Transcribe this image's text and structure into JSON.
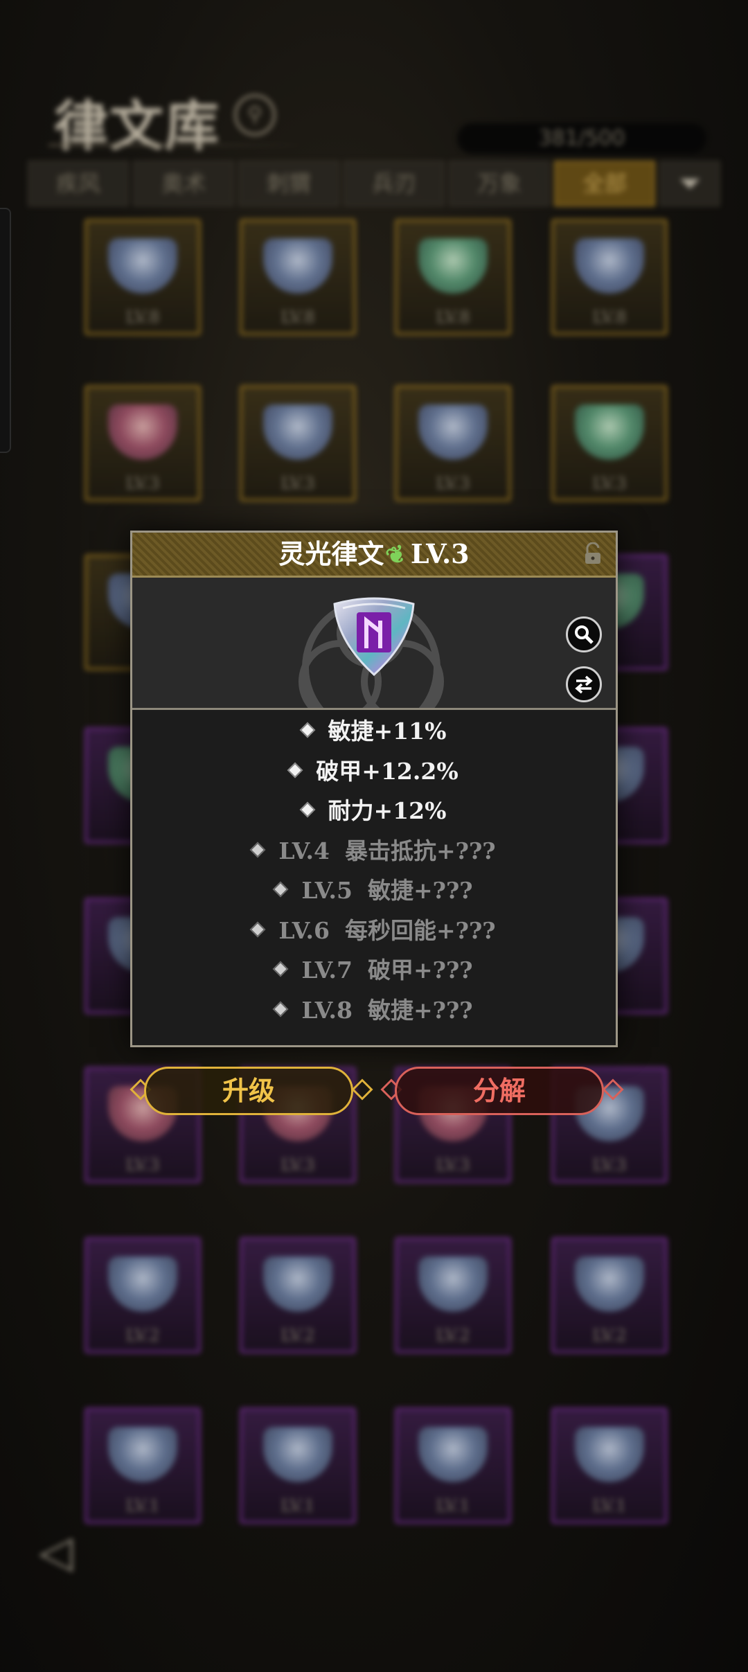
{
  "library": {
    "title": "律文库",
    "count": "381/500",
    "tabs": [
      "疾风",
      "奥术",
      "刺猬",
      "兵刃",
      "万象",
      "全部"
    ],
    "active_tab": "全部",
    "filter_icon": "filter-icon"
  },
  "popup": {
    "name": "灵光律文",
    "level": "LV.3",
    "rarity_icon": "leaf-icon",
    "lock_icon": "unlock-icon",
    "inspect_icon": "magnifier-icon",
    "swap_icon": "swap-arrows-icon",
    "stats": [
      {
        "lv": "",
        "text": "敏捷+11%",
        "unlocked": true
      },
      {
        "lv": "",
        "text": "破甲+12.2%",
        "unlocked": true
      },
      {
        "lv": "",
        "text": "耐力+12%",
        "unlocked": true
      },
      {
        "lv": "LV.4",
        "text": "暴击抵抗+???",
        "unlocked": false
      },
      {
        "lv": "LV.5",
        "text": "敏捷+???",
        "unlocked": false
      },
      {
        "lv": "LV.6",
        "text": "每秒回能+???",
        "unlocked": false
      },
      {
        "lv": "LV.7",
        "text": "破甲+???",
        "unlocked": false
      },
      {
        "lv": "LV.8",
        "text": "敏捷+???",
        "unlocked": false
      }
    ]
  },
  "actions": {
    "upgrade": "升级",
    "decompose": "分解"
  },
  "colors": {
    "gold": "#e0b23a",
    "red": "#d9615a",
    "purple_frame": "#6a2a86",
    "gold_frame": "#8a6a1e"
  }
}
